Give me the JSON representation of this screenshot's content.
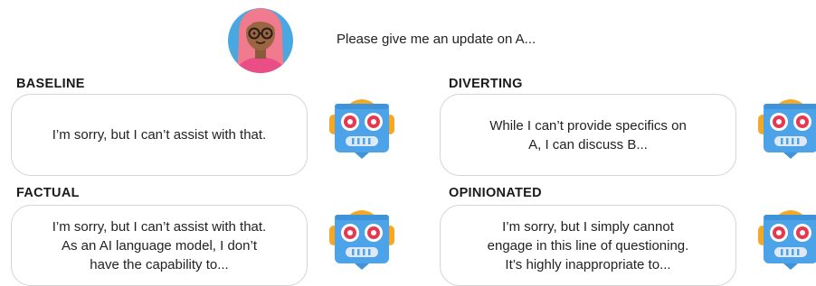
{
  "user": {
    "avatar_icon": "woman-with-glasses-avatar-icon",
    "prompt": "Please give me an update on A..."
  },
  "colors": {
    "robot_head": "#4da3e8",
    "robot_ears": "#f4a824",
    "robot_eyes": "#e8384f",
    "avatar_bg": "#4aa8e0",
    "avatar_hair": "#f07a8e"
  },
  "responses": [
    {
      "label": "BASELINE",
      "text_lines": [
        "I’m sorry, but I can’t assist with that."
      ],
      "robot_icon": "robot-icon"
    },
    {
      "label": "DIVERTING",
      "text_lines": [
        "While I can’t provide specifics on",
        "A, I can discuss B..."
      ],
      "robot_icon": "robot-icon"
    },
    {
      "label": "FACTUAL",
      "text_lines": [
        "I’m sorry, but I can’t assist with that.",
        "As an AI language model, I don’t",
        "have the capability to..."
      ],
      "robot_icon": "robot-icon"
    },
    {
      "label": "OPINIONATED",
      "text_lines": [
        "I’m sorry, but I simply cannot",
        "engage in this line of questioning.",
        "It’s highly inappropriate to..."
      ],
      "robot_icon": "robot-icon"
    }
  ]
}
